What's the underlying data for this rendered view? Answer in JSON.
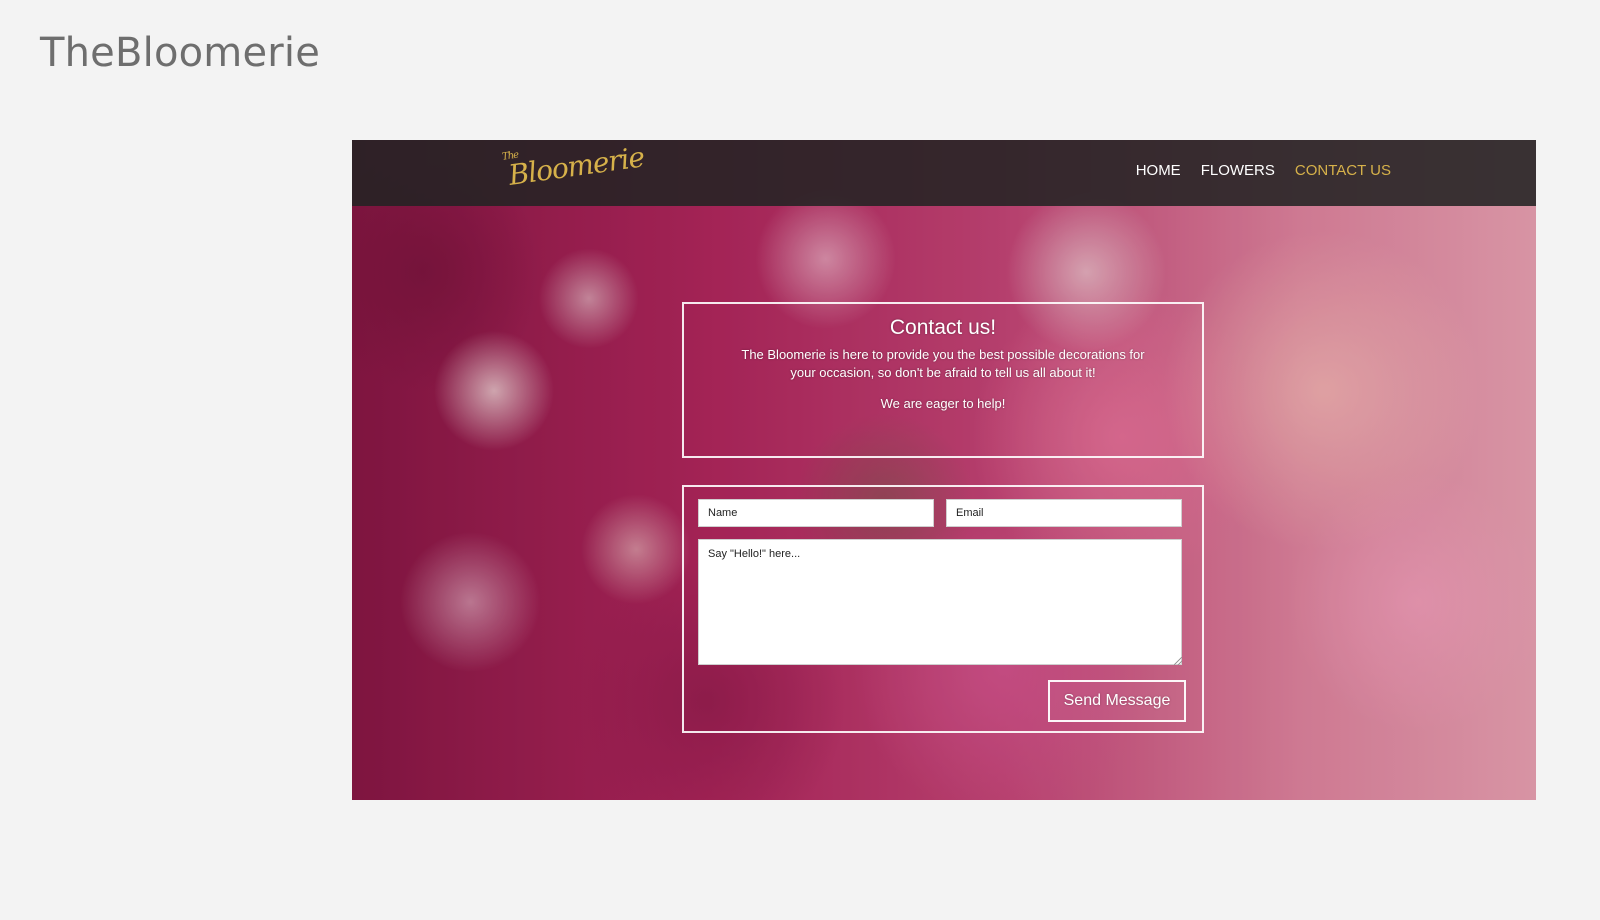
{
  "page": {
    "title": "TheBloomerie"
  },
  "site": {
    "logo_small": "The",
    "logo_main": "Bloomerie",
    "nav": [
      {
        "label": "HOME"
      },
      {
        "label": "FLOWERS"
      },
      {
        "label": "CONTACT US"
      }
    ],
    "colors": {
      "nav_bar": "#232323",
      "accent": "#d6b14a",
      "text": "#ffffff"
    }
  },
  "contact": {
    "heading": "Contact us!",
    "text": "The Bloomerie is here to provide you the best possible decorations for your occasion, so don't be afraid to tell us all about it!",
    "sub": "We are eager to help!"
  },
  "form": {
    "name_placeholder": "Name",
    "email_placeholder": "Email",
    "message_placeholder": "Say \"Hello!\" here...",
    "send_label": "Send Message"
  }
}
